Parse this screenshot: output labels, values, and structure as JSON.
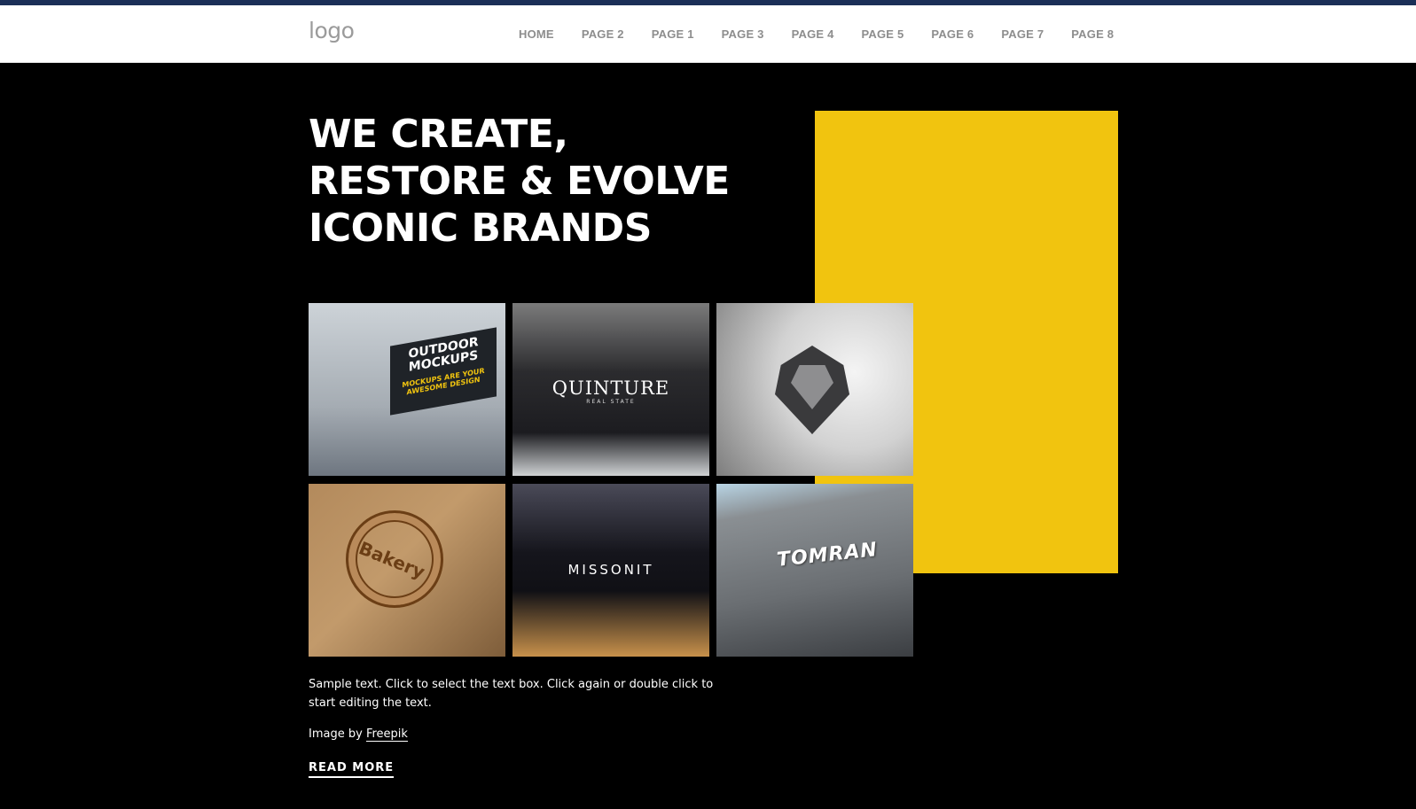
{
  "header": {
    "logo_text": "logo",
    "nav": [
      "HOME",
      "PAGE 2",
      "PAGE 1",
      "PAGE 3",
      "PAGE 4",
      "PAGE 5",
      "PAGE 6",
      "PAGE 7",
      "PAGE 8"
    ]
  },
  "hero": {
    "headline": "WE CREATE,\nRESTORE & EVOLVE\nICONIC BRANDS",
    "accent_color": "#f1c40f",
    "gallery": [
      {
        "sign_line1": "OUTDOOR MOCKUPS",
        "sign_line2": "MOCKUPS ARE YOUR AWESOME DESIGN"
      },
      {
        "sign_line1": "QUINTURE",
        "sign_line2": "REAL STATE"
      },
      {
        "icon": "lion-logo-icon"
      },
      {
        "sign_line1": "Bakery"
      },
      {
        "sign_line1": "MISSONIT"
      },
      {
        "sign_line1": "TOMRAN"
      }
    ],
    "body_text": "Sample text. Click to select the text box. Click again or double click to start editing the text.",
    "credit_prefix": "Image by",
    "credit_link": "Freepik",
    "read_more": "READ MORE"
  }
}
